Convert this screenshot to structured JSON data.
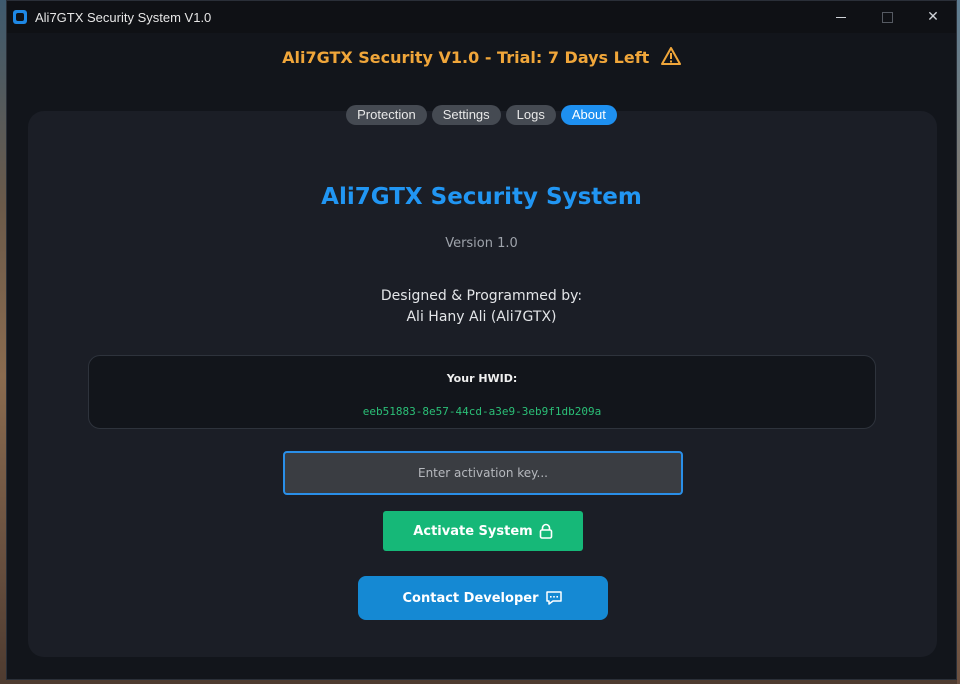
{
  "window": {
    "title": "Ali7GTX Security System V1.0",
    "controls": {
      "minimize": "minimize",
      "maximize": "maximize",
      "close": "✕"
    }
  },
  "header": {
    "trial_text": "Ali7GTX Security V1.0 - Trial: 7 Days Left",
    "warning_icon": "warning-icon"
  },
  "tabs": [
    {
      "label": "Protection",
      "active": false
    },
    {
      "label": "Settings",
      "active": false
    },
    {
      "label": "Logs",
      "active": false
    },
    {
      "label": "About",
      "active": true
    }
  ],
  "about": {
    "app_name": "Ali7GTX Security System",
    "version": "Version 1.0",
    "credits_line1": "Designed & Programmed by:",
    "credits_line2": "Ali Hany Ali (Ali7GTX)"
  },
  "hwid": {
    "label": "Your HWID:",
    "value": "eeb51883-8e57-44cd-a3e9-3eb9f1db209a"
  },
  "activation": {
    "placeholder": "Enter activation key...",
    "value": "",
    "activate_label": "Activate System",
    "activate_icon": "lock-icon",
    "contact_label": "Contact Developer",
    "contact_icon": "chat-icon"
  },
  "colors": {
    "accent": "#1e90f0",
    "trial_warning": "#f0a63a",
    "hwid_text": "#2bbf77",
    "activate_button": "#16b878",
    "contact_button": "#1589d3",
    "panel": "#1b1e26",
    "window_bg": "#12151b"
  }
}
